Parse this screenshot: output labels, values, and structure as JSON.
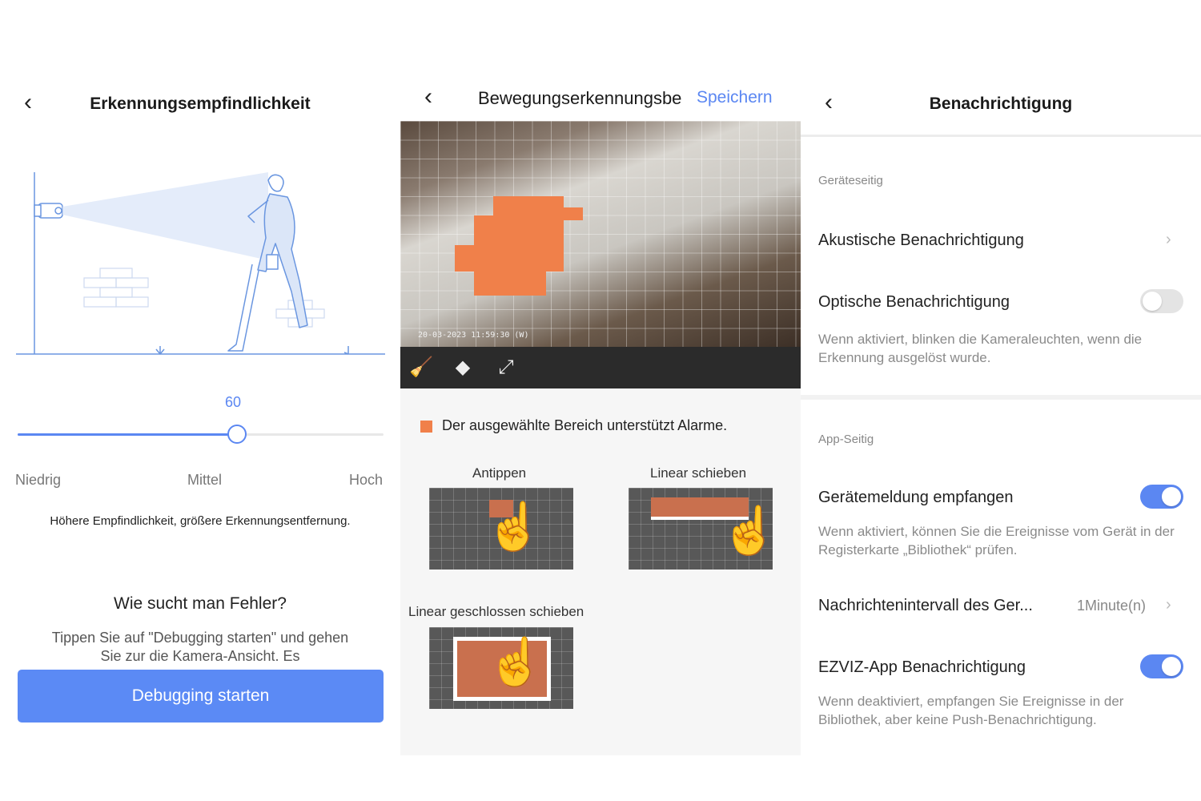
{
  "panel1": {
    "back_icon": "chevron-left-icon",
    "title": "Erkennungsempfindlichkeit",
    "slider": {
      "value": 60,
      "min": 0,
      "max": 100,
      "value_label": "60"
    },
    "ticks": [
      "Niedrig",
      "Mittel",
      "Hoch"
    ],
    "hint": "Höhere Empfindlichkeit, größere Erkennungsentfernung.",
    "help_title": "Wie sucht man Fehler?",
    "help_text": "Tippen Sie auf \"Debugging starten\" und gehen Sie zur die Kamera-Ansicht. Es",
    "button": "Debugging starten",
    "accent": "#5b87f2"
  },
  "panel2": {
    "back_icon": "chevron-left-icon",
    "title": "Bewegungserkennungsbe",
    "save": "Speichern",
    "timestamp": "20-03-2023 11:59:30  (W)",
    "toolbar_icons": [
      "brush-icon",
      "eraser-icon",
      "expand-icon"
    ],
    "legend": "Der ausgewählte Bereich unterstützt Alarme.",
    "zone_color": "#f0804a",
    "demos": [
      {
        "label": "Antippen"
      },
      {
        "label": "Linear schieben"
      },
      {
        "label": "Linear geschlossen schieben"
      }
    ]
  },
  "panel3": {
    "back_icon": "chevron-left-icon",
    "title": "Benachrichtigung",
    "section_device": "Geräteseitig",
    "acoustic": "Akustische Benachrichtigung",
    "optical": "Optische Benachrichtigung",
    "optical_on": false,
    "optical_desc": "Wenn aktiviert, blinken die Kameraleuchten, wenn die Erkennung ausgelöst wurde.",
    "section_app": "App-Seitig",
    "device_msg": "Gerätemeldung empfangen",
    "device_msg_on": true,
    "device_msg_desc": "Wenn aktiviert, können Sie die Ereignisse vom Gerät in der Registerkarte „Bibliothek“ prüfen.",
    "interval_label": "Nachrichtenintervall des Ger...",
    "interval_value": "1Minute(n)",
    "ezviz": "EZVIZ-App Benachrichtigung",
    "ezviz_on": true,
    "ezviz_desc": "Wenn deaktiviert, empfangen Sie Ereignisse in der Bibliothek, aber keine Push-Benachrichtigung.",
    "accent": "#5b87f2"
  }
}
